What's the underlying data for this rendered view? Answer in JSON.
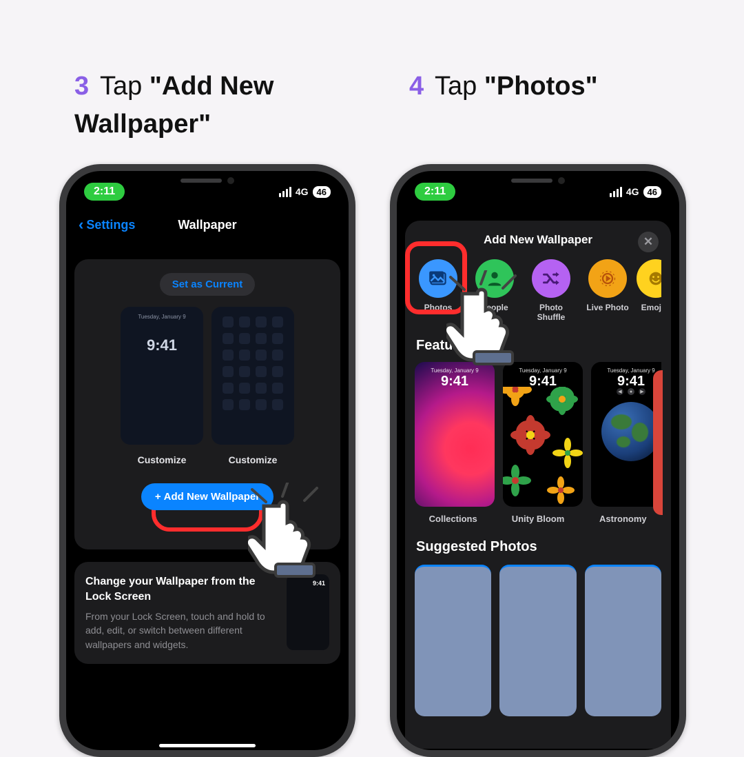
{
  "steps": [
    {
      "num": "3",
      "prefix": "Tap ",
      "bold": "\"Add New Wallpaper\""
    },
    {
      "num": "4",
      "prefix": "Tap ",
      "bold": "\"Photos\""
    }
  ],
  "status": {
    "time": "2:11",
    "network": "4G",
    "battery_label": "46"
  },
  "phone1": {
    "back_label": "Settings",
    "title": "Wallpaper",
    "set_current": "Set as Current",
    "preview_date": "Tuesday, January 9",
    "preview_time": "9:41",
    "customize": "Customize",
    "add_button": "Add New Wallpaper",
    "tip_title": "Change your Wallpaper from the Lock Screen",
    "tip_body": "From your Lock Screen, touch and hold to add, edit, or switch between different wallpapers and widgets.",
    "tip_mini_time": "9:41"
  },
  "phone2": {
    "sheet_title": "Add New Wallpaper",
    "categories": [
      {
        "key": "photos",
        "label": "Photos",
        "color": "#3a97ff"
      },
      {
        "key": "people",
        "label": "People",
        "color": "#2fc45a"
      },
      {
        "key": "shuffle",
        "label": "Photo Shuffle",
        "color": "#b562f2"
      },
      {
        "key": "livephoto",
        "label": "Live Photo",
        "color": "#f2a316"
      },
      {
        "key": "emoji",
        "label": "Emoji",
        "color": "#ffd21f"
      }
    ],
    "featured_title": "Featured",
    "featured": [
      {
        "label": "Collections"
      },
      {
        "label": "Unity Bloom"
      },
      {
        "label": "Astronomy"
      }
    ],
    "featured_date": "Tuesday, January 9",
    "featured_time": "9:41",
    "suggested_title": "Suggested Photos"
  }
}
